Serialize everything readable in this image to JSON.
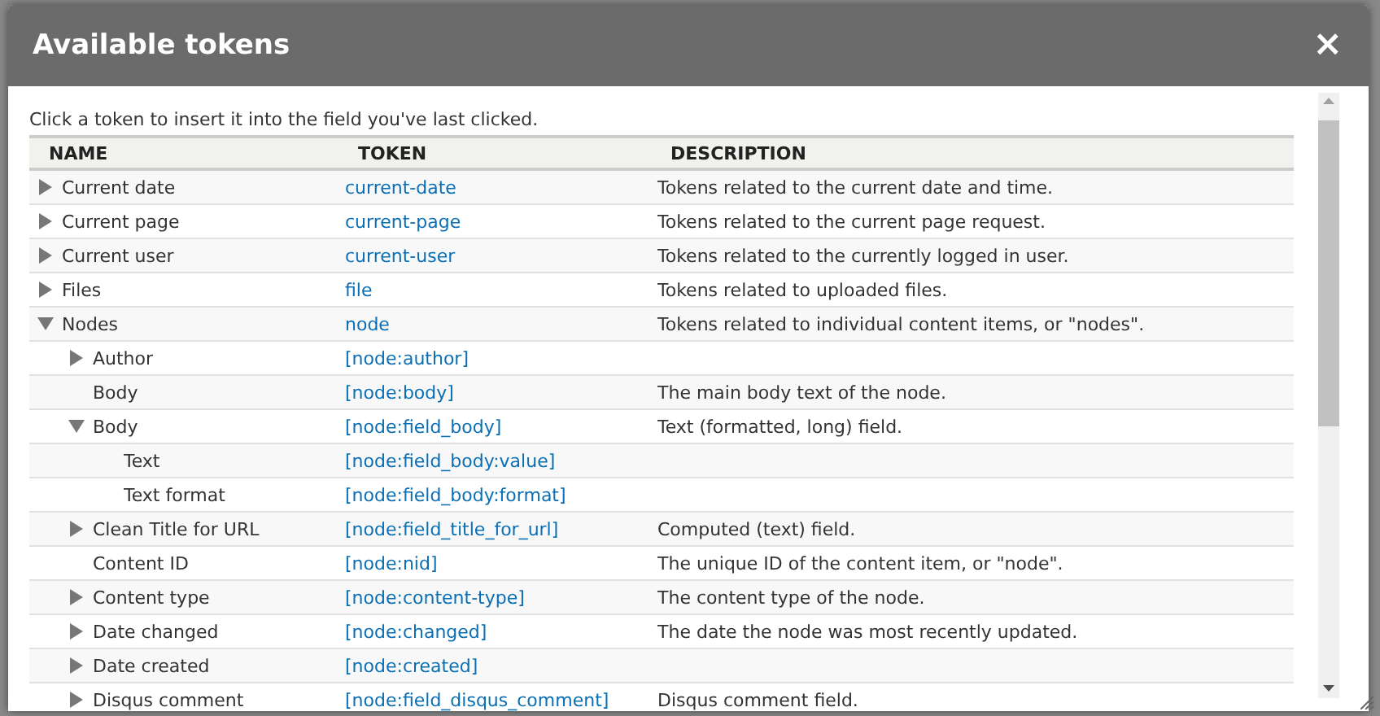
{
  "dialog": {
    "title": "Available tokens",
    "close": "×",
    "intro": "Click a token to insert it into the field you've last clicked.",
    "table": {
      "columns": [
        "NAME",
        "TOKEN",
        "DESCRIPTION"
      ],
      "rows": [
        {
          "kind": "group",
          "expanded": false,
          "name": "Current date",
          "token": "current-date",
          "description": "Tokens related to the current date and time."
        },
        {
          "kind": "group",
          "expanded": false,
          "name": "Current page",
          "token": "current-page",
          "description": "Tokens related to the current page request."
        },
        {
          "kind": "group",
          "expanded": false,
          "name": "Current user",
          "token": "current-user",
          "description": "Tokens related to the currently logged in user."
        },
        {
          "kind": "group",
          "expanded": false,
          "name": "Files",
          "token": "file",
          "description": "Tokens related to uploaded files."
        },
        {
          "kind": "group",
          "expanded": true,
          "name": "Nodes",
          "token": "node",
          "description": "Tokens related to individual content items, or \"nodes\".",
          "children": [
            {
              "kind": "group",
              "expanded": false,
              "name": "Author",
              "token": "[node:author]"
            },
            {
              "kind": "leaf",
              "name": "Body",
              "token": "[node:body]",
              "description": "The main body text of the node."
            },
            {
              "kind": "group",
              "expanded": true,
              "name": "Body",
              "token": "[node:field_body]",
              "description": "Text (formatted, long) field.",
              "children": [
                {
                  "kind": "leaf",
                  "name": "Text",
                  "token": "[node:field_body:value]"
                },
                {
                  "kind": "leaf",
                  "name": "Text format",
                  "token": "[node:field_body:format]"
                }
              ]
            },
            {
              "kind": "group",
              "expanded": false,
              "name": "Clean Title for URL",
              "token": "[node:field_title_for_url]",
              "description": "Computed (text) field."
            },
            {
              "kind": "leaf",
              "name": "Content ID",
              "token": "[node:nid]",
              "description": "The unique ID of the content item, or \"node\"."
            },
            {
              "kind": "group",
              "expanded": false,
              "name": "Content type",
              "token": "[node:content-type]",
              "description": "The content type of the node."
            },
            {
              "kind": "group",
              "expanded": false,
              "name": "Date changed",
              "token": "[node:changed]",
              "description": "The date the node was most recently updated."
            },
            {
              "kind": "group",
              "expanded": false,
              "name": "Date created",
              "token": "[node:created]"
            },
            {
              "kind": "group",
              "expanded": false,
              "name": "Disqus comment",
              "token": "[node:field_disqus_comment]",
              "description": "Disqus comment field."
            }
          ]
        }
      ]
    }
  }
}
